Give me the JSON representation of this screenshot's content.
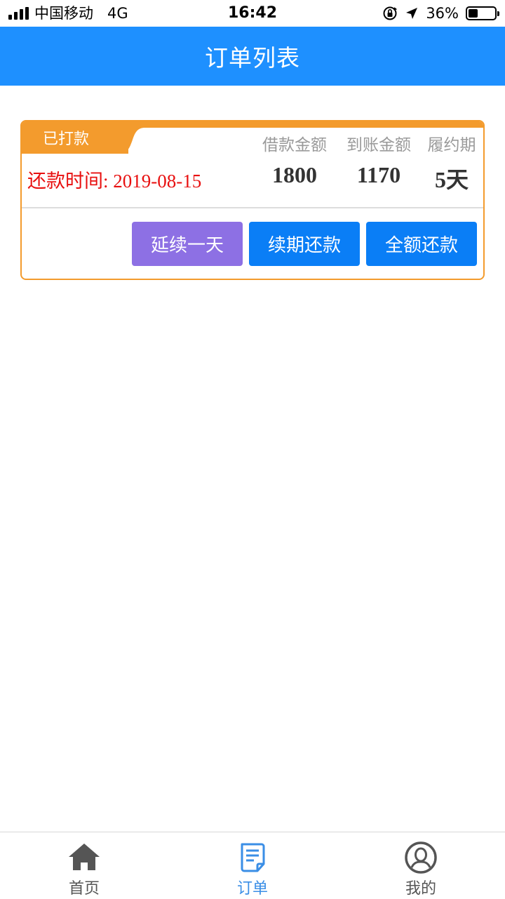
{
  "status_bar": {
    "carrier": "中国移动",
    "network": "4G",
    "time": "16:42",
    "battery_percent": "36%",
    "battery_level": 0.36
  },
  "header": {
    "title": "订单列表"
  },
  "order": {
    "status_label": "已打款",
    "repay_label": "还款时间: 2019-08-15",
    "columns": [
      {
        "label": "借款金额",
        "value": "1800"
      },
      {
        "label": "到账金额",
        "value": "1170"
      },
      {
        "label": "履约期",
        "value": "5天"
      }
    ],
    "buttons": {
      "extend": "延续一天",
      "renew": "续期还款",
      "full": "全额还款"
    }
  },
  "tabbar": {
    "items": [
      {
        "label": "首页",
        "icon": "home-icon",
        "color": "#555555"
      },
      {
        "label": "订单",
        "icon": "order-list-icon",
        "color": "#3a8ee6"
      },
      {
        "label": "我的",
        "icon": "user-profile-icon",
        "color": "#555555"
      }
    ]
  },
  "colors": {
    "header_bg": "#1e90ff",
    "card_accent": "#f39b2d",
    "repay_text": "#e81010",
    "btn_purple": "#8d70e4",
    "btn_blue": "#0a7ef6",
    "tab_active": "#3a8ee6"
  }
}
